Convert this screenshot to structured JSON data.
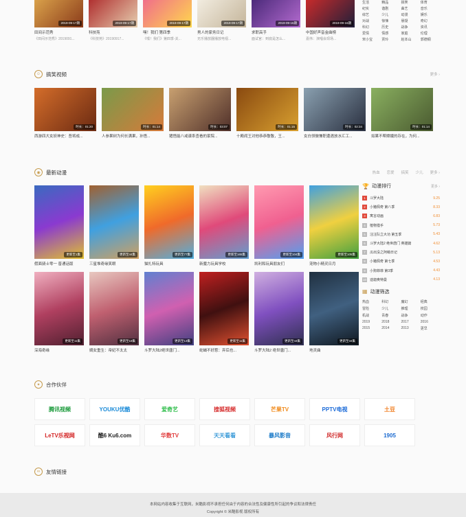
{
  "top_row": {
    "items": [
      {
        "date": "2019-09-17期",
        "title": "田间示范秀",
        "sub": "《田间示范秀》2019091..."
      },
      {
        "date": "2019-09-17期",
        "title": "科技苑",
        "sub": "《科技苑》20190917..."
      },
      {
        "date": "2019-09-17期",
        "title": "嘿！我们 第四季",
        "sub": "《嘿！我们》第四季-关..."
      },
      {
        "date": "2019-09-17期",
        "title": "男人的家务日记",
        "sub": "无乐播放器播放电视..."
      },
      {
        "date": "2019-09-16期",
        "title": "求职高手",
        "sub": "面试官：到底是怎么..."
      },
      {
        "date": "2019-09-16期",
        "title": "中国好声音金曲榜",
        "sub": "嘉伟：演唱会现场..."
      }
    ],
    "genres": [
      "生活",
      "精品",
      "搞笑",
      "体育",
      "纪实",
      "谐剧",
      "曲艺",
      "音乐",
      "综艺",
      "少儿",
      "动漫",
      "娱乐",
      "对战",
      "惊悚",
      "悬疑",
      "奇幻",
      "科幻",
      "历史",
      "战争",
      "资讯",
      "爱情",
      "情感",
      "家庭",
      "伦理",
      "宋小宝",
      "贾玲",
      "赵本山",
      "郭德纲"
    ]
  },
  "funny": {
    "title": "搞笑视频",
    "more": "更多 ›",
    "items": [
      {
        "dur": "时长：01:20",
        "title": "西游四大女妖神史：吾将成..."
      },
      {
        "dur": "时长：01:14",
        "title": "人参果树为何长满果，孙悟..."
      },
      {
        "dur": "时长：03:07",
        "title": "猪悟能八戒谱系查看的家院..."
      },
      {
        "dur": "时长：01:15",
        "title": "十殿阎王对他恭恭敬敬，王..."
      },
      {
        "dur": "时长：02:34",
        "title": "女白领做兼职遭遇放水汇工..."
      },
      {
        "dur": "时长：01:14",
        "title": "如果不帮嫦娥的存在，为何..."
      }
    ]
  },
  "anime": {
    "title": "最新动漫",
    "filters": [
      "热血",
      "恋爱",
      "搞笑",
      "少儿"
    ],
    "more": "更多 ›",
    "row1": [
      {
        "tag": "更新至1集",
        "title": "假面骑士零一 普通话版"
      },
      {
        "tag": "更新至44集",
        "title": "三星堆奇缘笑眼"
      },
      {
        "tag": "更新至77集",
        "title": "猫扎特玩具"
      },
      {
        "tag": "更新至165集",
        "title": "新魔力玩具学校"
      },
      {
        "tag": "更新至104集",
        "title": "凯利和玩具朋友们"
      },
      {
        "tag": "更新至105集",
        "title": "宠物小精灵日月"
      }
    ],
    "row2": [
      {
        "tag": "更新至11集",
        "title": "深海奇缘"
      },
      {
        "tag": "更新至18集",
        "title": "嫡女重生：帝妃不太太"
      },
      {
        "tag": "更新至13集",
        "title": "斗罗大陆2绝世唐门..."
      },
      {
        "tag": "更新至11集",
        "title": "蛇蝎不好惹：弃后也..."
      },
      {
        "tag": "更新至44集",
        "title": "斗罗大陆2 绝世唐门..."
      },
      {
        "tag": "更新至34集",
        "title": "地灵曲"
      }
    ]
  },
  "ranking": {
    "title": "动漫排行",
    "more": "更多 ›",
    "items": [
      {
        "n": "1",
        "name": "斗罗大陆",
        "score": "9.25"
      },
      {
        "n": "2",
        "name": "小猪佩奇 第八季",
        "score": "8.33"
      },
      {
        "n": "3",
        "name": "寓言动画",
        "score": "6.83"
      },
      {
        "n": "4",
        "name": "植物猎手",
        "score": "5.73"
      },
      {
        "n": "5",
        "name": "汪汪队立大功 第五季",
        "score": "5.43"
      },
      {
        "n": "6",
        "name": "斗罗大陆2 绝世唐门 英雄篇",
        "score": "4.62"
      },
      {
        "n": "7",
        "name": "瓜出没之阿萌日记",
        "score": "5.13"
      },
      {
        "n": "8",
        "name": "小猪佩奇 第七季",
        "score": "4.53"
      },
      {
        "n": "9",
        "name": "小狗菲菲 第3季",
        "score": "4.43"
      },
      {
        "n": "10",
        "name": "迪迦奥特曼",
        "score": "4.13"
      }
    ],
    "filter_title": "动漫筛选",
    "filters": [
      "热血",
      "科幻",
      "魔幻",
      "经典",
      "冒险",
      "少儿",
      "推理",
      "校园",
      "机战",
      "青春",
      "战争",
      "动作",
      "2019",
      "2018",
      "2017",
      "2016",
      "2015",
      "2014",
      "2013",
      "更早"
    ]
  },
  "partners": {
    "title": "合作伙伴",
    "row1": [
      {
        "name": "腾讯视频",
        "color": "#1a9a3a"
      },
      {
        "name": "YOUKU优酷",
        "color": "#1b8bd8"
      },
      {
        "name": "爱奇艺",
        "color": "#2ebd4a"
      },
      {
        "name": "搜狐视频",
        "color": "#d62d2d"
      },
      {
        "name": "芒果TV",
        "color": "#f08a1a"
      },
      {
        "name": "PPTV电视",
        "color": "#1a6ad8"
      },
      {
        "name": "土豆",
        "color": "#f07a1a"
      }
    ],
    "row2": [
      {
        "name": "LeTV乐视网",
        "color": "#d32222"
      },
      {
        "name": "酷6 Ku6.com",
        "color": "#222222"
      },
      {
        "name": "华数TV",
        "color": "#e03a3a"
      },
      {
        "name": "天天看看",
        "color": "#3a9ad8"
      },
      {
        "name": "暴风影音",
        "color": "#1a7ac8"
      },
      {
        "name": "风行网",
        "color": "#d02a2a"
      },
      {
        "name": "1905",
        "color": "#1a6ad0"
      }
    ]
  },
  "links": {
    "title": "友情链接"
  },
  "footer": {
    "line1": "本网站内容收集于互联网，米酷影视不承担任何由于内容的合法性及健康性所引起的争议和法律责任",
    "line2": "Copyright © 米酷影视 版权所有"
  }
}
